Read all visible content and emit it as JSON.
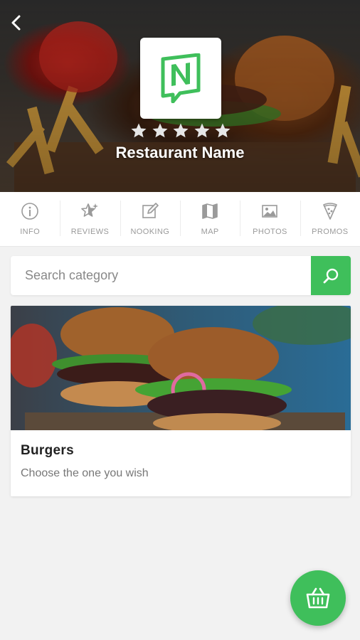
{
  "header": {
    "back_icon": "chevron-left-icon",
    "logo_icon": "n-location-logo",
    "rating": 5,
    "restaurant_name": "Restaurant Name"
  },
  "tabs": [
    {
      "label": "INFO",
      "icon": "info-icon"
    },
    {
      "label": "REVIEWS",
      "icon": "star-sparkle-icon"
    },
    {
      "label": "NOOKING",
      "icon": "edit-icon"
    },
    {
      "label": "MAP",
      "icon": "map-icon"
    },
    {
      "label": "PHOTOS",
      "icon": "photo-icon"
    },
    {
      "label": "PROMOS",
      "icon": "pizza-icon"
    }
  ],
  "search": {
    "placeholder": "Search category",
    "button_icon": "search-icon"
  },
  "categories": [
    {
      "title": "Burgers",
      "subtitle": "Choose the one you wish"
    }
  ],
  "fab": {
    "icon": "basket-icon"
  },
  "colors": {
    "accent": "#3fbf5b",
    "tab_text": "#9a9a9a",
    "background": "#f2f2f2"
  }
}
